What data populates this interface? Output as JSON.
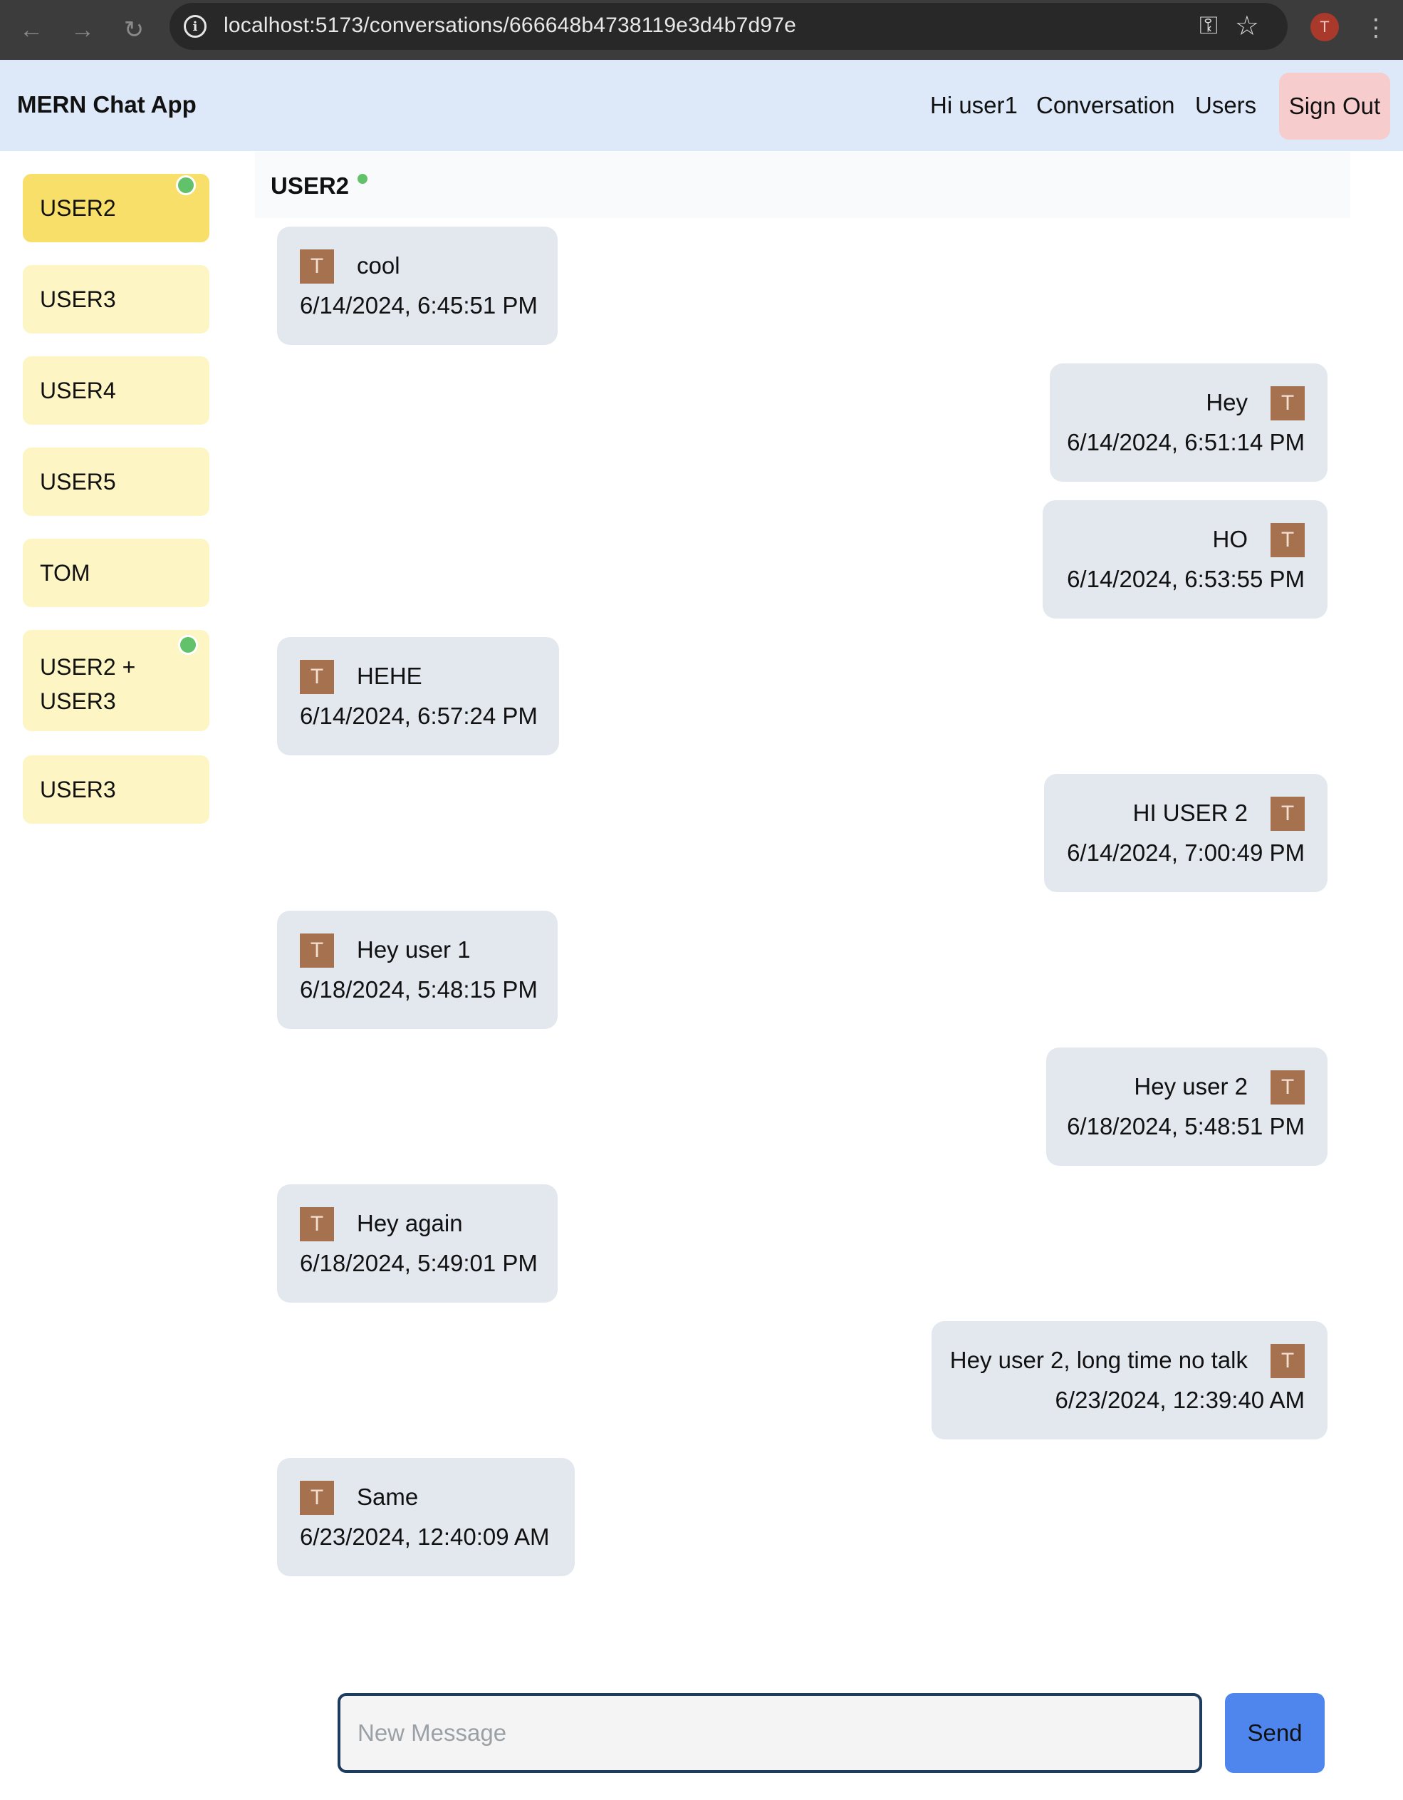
{
  "browser": {
    "url": "localhost:5173/conversations/666648b4738119e3d4b7d97e",
    "back_icon": "←",
    "forward_icon": "→",
    "reload_icon": "↻",
    "info_icon": "i",
    "key_icon": "⚿",
    "star_icon": "☆",
    "profile_initial": "T",
    "menu_icon": "⋮"
  },
  "header": {
    "brand": "MERN Chat App",
    "greeting": "Hi user1",
    "nav": [
      "Conversation",
      "Users"
    ],
    "signout_label": "Sign Out"
  },
  "sidebar": {
    "items": [
      {
        "label": "USER2",
        "active": true,
        "online": true
      },
      {
        "label": "USER3",
        "active": false,
        "online": false
      },
      {
        "label": "USER4",
        "active": false,
        "online": false
      },
      {
        "label": "USER5",
        "active": false,
        "online": false
      },
      {
        "label": "TOM",
        "active": false,
        "online": false
      },
      {
        "label_line1": "USER2 +",
        "label_line2": "USER3",
        "active": false,
        "online": true
      },
      {
        "label": "USER3",
        "active": false,
        "online": false
      }
    ]
  },
  "conversation": {
    "title": "USER2",
    "online": true,
    "messages": [
      {
        "side": "left",
        "avatar": "T",
        "text": "cool",
        "time": "6/14/2024, 6:45:51 PM"
      },
      {
        "side": "right",
        "avatar": "T",
        "text": "Hey",
        "time": "6/14/2024, 6:51:14 PM"
      },
      {
        "side": "right",
        "avatar": "T",
        "text": "HO",
        "time": "6/14/2024, 6:53:55 PM"
      },
      {
        "side": "left",
        "avatar": "T",
        "text": "HEHE",
        "time": "6/14/2024, 6:57:24 PM"
      },
      {
        "side": "right",
        "avatar": "T",
        "text": "HI USER 2",
        "time": "6/14/2024, 7:00:49 PM"
      },
      {
        "side": "left",
        "avatar": "T",
        "text": "Hey user 1",
        "time": "6/18/2024, 5:48:15 PM"
      },
      {
        "side": "right",
        "avatar": "T",
        "text": "Hey user 2",
        "time": "6/18/2024, 5:48:51 PM"
      },
      {
        "side": "left",
        "avatar": "T",
        "text": "Hey again",
        "time": "6/18/2024, 5:49:01 PM"
      },
      {
        "side": "right",
        "avatar": "T",
        "text": "Hey user 2, long time no talk",
        "time": "6/23/2024, 12:39:40 AM"
      },
      {
        "side": "left",
        "avatar": "T",
        "text": "Same",
        "time": "6/23/2024, 12:40:09 AM"
      }
    ]
  },
  "composer": {
    "placeholder": "New Message",
    "value": "",
    "send_label": "Send"
  },
  "colors": {
    "header_bg": "#dde8f8",
    "signout_bg": "#f6cccc",
    "sidebar_active": "#f8df6a",
    "sidebar_item": "#fdf6c4",
    "bubble_bg": "#e3e8ef",
    "avatar_bg": "#a6714f",
    "online": "#61c26b",
    "send_bg": "#4f86ee"
  }
}
